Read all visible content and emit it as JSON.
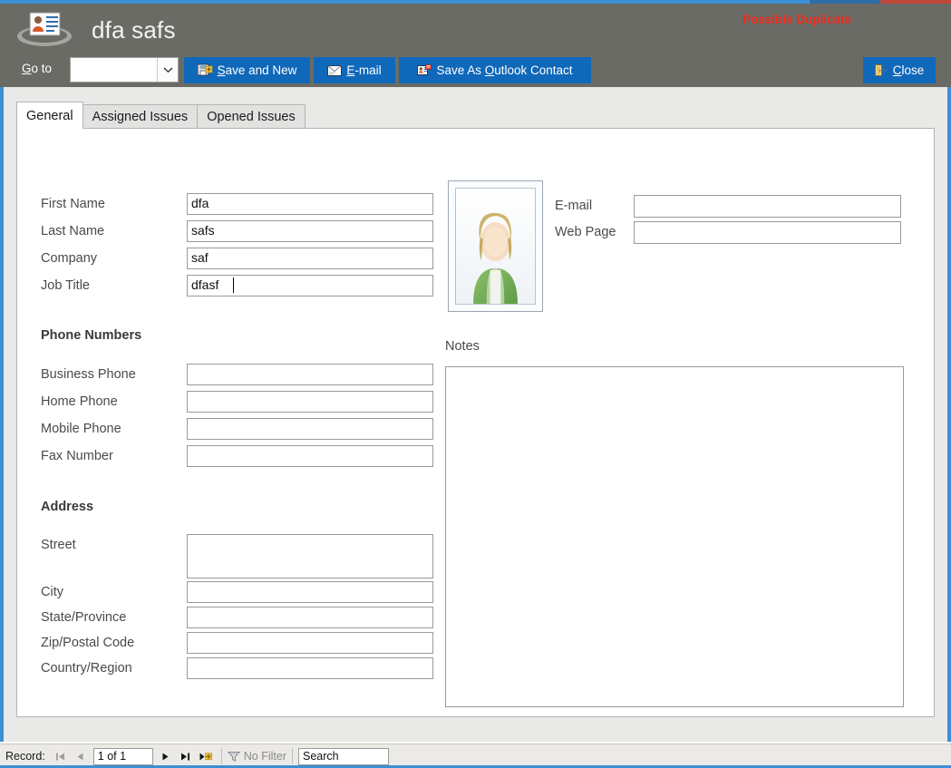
{
  "window": {
    "title": "dfa safs",
    "app_icon": "contact-card-icon",
    "duplicate_warning": "Possible Duplicate",
    "accent_color": "#3c8fd4",
    "warning_color": "#ee2b1c",
    "header_color": "#6b6b66",
    "button_color": "#0f68ba"
  },
  "toolbar": {
    "goto_label_pre": "G",
    "goto_label_post": "o to",
    "goto_value": "",
    "buttons": [
      {
        "id": "save-and-new",
        "pre": "",
        "accel": "S",
        "post": "ave and New",
        "icon": "save-new-icon"
      },
      {
        "id": "email",
        "pre": "",
        "accel": "E",
        "post": "-mail",
        "icon": "email-icon"
      },
      {
        "id": "save-as-outlook-contact",
        "pre": "Save As ",
        "accel": "O",
        "post": "utlook Contact",
        "icon": "outlook-contact-icon"
      },
      {
        "id": "close",
        "pre": "",
        "accel": "C",
        "post": "lose",
        "icon": "close-door-icon"
      }
    ]
  },
  "tabs": [
    {
      "id": "general",
      "label": "General",
      "active": true
    },
    {
      "id": "assigned-issues",
      "label": "Assigned Issues",
      "active": false
    },
    {
      "id": "opened-issues",
      "label": "Opened Issues",
      "active": false
    }
  ],
  "form": {
    "identity": [
      {
        "id": "first-name",
        "label": "First Name",
        "value": "dfa"
      },
      {
        "id": "last-name",
        "label": "Last Name",
        "value": "safs"
      },
      {
        "id": "company",
        "label": "Company",
        "value": "saf"
      },
      {
        "id": "job-title",
        "label": "Job Title",
        "value": "dfasf",
        "focused": true
      }
    ],
    "contact": [
      {
        "id": "email",
        "label": "E-mail",
        "value": ""
      },
      {
        "id": "web-page",
        "label": "Web Page",
        "value": ""
      }
    ],
    "phone_section_title": "Phone Numbers",
    "phones": [
      {
        "id": "business-phone",
        "label": "Business Phone",
        "value": ""
      },
      {
        "id": "home-phone",
        "label": "Home Phone",
        "value": ""
      },
      {
        "id": "mobile-phone",
        "label": "Mobile Phone",
        "value": ""
      },
      {
        "id": "fax-number",
        "label": "Fax Number",
        "value": ""
      }
    ],
    "address_section_title": "Address",
    "address": [
      {
        "id": "street",
        "label": "Street",
        "value": ""
      },
      {
        "id": "city",
        "label": "City",
        "value": ""
      },
      {
        "id": "state-province",
        "label": "State/Province",
        "value": ""
      },
      {
        "id": "zip-postal-code",
        "label": "Zip/Postal Code",
        "value": ""
      },
      {
        "id": "country-region",
        "label": "Country/Region",
        "value": ""
      }
    ],
    "notes_label": "Notes",
    "notes_value": "",
    "photo_alt": "contact-photo-placeholder"
  },
  "statusbar": {
    "record_label": "Record:",
    "record_position": "1 of 1",
    "filter_label": "No Filter",
    "search_value": "Search",
    "nav": {
      "first": "first-record",
      "previous": "previous-record",
      "next": "next-record",
      "last": "last-record",
      "new": "new-record"
    }
  }
}
